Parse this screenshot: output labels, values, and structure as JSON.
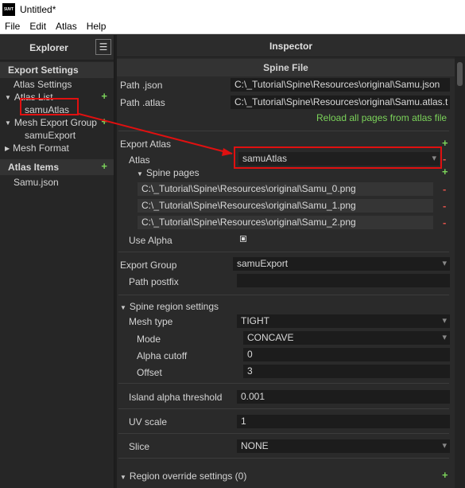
{
  "window": {
    "icon_text": "SUVT",
    "title": "Untitled*"
  },
  "menu": [
    "File",
    "Edit",
    "Atlas",
    "Help"
  ],
  "explorer": {
    "title": "Explorer",
    "menu_button": "☰",
    "export_settings": "Export Settings",
    "atlas_settings": "Atlas Settings",
    "atlas_list": "Atlas List",
    "atlas_item": "samuAtlas",
    "mesh_export_group": "Mesh Export Group",
    "mesh_export_item": "samuExport",
    "mesh_format": "Mesh Format",
    "atlas_items_header": "Atlas Items",
    "atlas_items_file": "Samu.json",
    "plus": "+"
  },
  "inspector": {
    "title": "Inspector",
    "section": "Spine File",
    "path_json_label": "Path .json",
    "path_json_value": "C:\\_Tutorial\\Spine\\Resources\\original\\Samu.json",
    "path_atlas_label": "Path .atlas",
    "path_atlas_value": "C:\\_Tutorial\\Spine\\Resources\\original\\Samu.atlas.t",
    "reload_link": "Reload all pages from atlas file",
    "export_atlas_label": "Export Atlas",
    "atlas_label": "Atlas",
    "atlas_value": "samuAtlas",
    "spine_pages_label": "Spine pages",
    "spine_pages": [
      "C:\\_Tutorial\\Spine\\Resources\\original\\Samu_0.png",
      "C:\\_Tutorial\\Spine\\Resources\\original\\Samu_1.png",
      "C:\\_Tutorial\\Spine\\Resources\\original\\Samu_2.png"
    ],
    "use_alpha_label": "Use Alpha",
    "export_group_label": "Export Group",
    "export_group_value": "samuExport",
    "path_postfix_label": "Path postfix",
    "path_postfix_value": "",
    "region_settings_label": "Spine region settings",
    "mesh_type_label": "Mesh type",
    "mesh_type_value": "TIGHT",
    "mode_label": "Mode",
    "mode_value": "CONCAVE",
    "alpha_cutoff_label": "Alpha cutoff",
    "alpha_cutoff_value": "0",
    "offset_label": "Offset",
    "offset_value": "3",
    "island_label": "Island alpha threshold",
    "island_value": "0.001",
    "uv_scale_label": "UV scale",
    "uv_scale_value": "1",
    "slice_label": "Slice",
    "slice_value": "NONE",
    "region_override_label": "Region override settings (0)",
    "plus": "+",
    "minus": "-"
  },
  "colors": {
    "accent_green": "#7bd35a",
    "remove_red": "#e0524a",
    "annotation_red": "#e01010"
  }
}
